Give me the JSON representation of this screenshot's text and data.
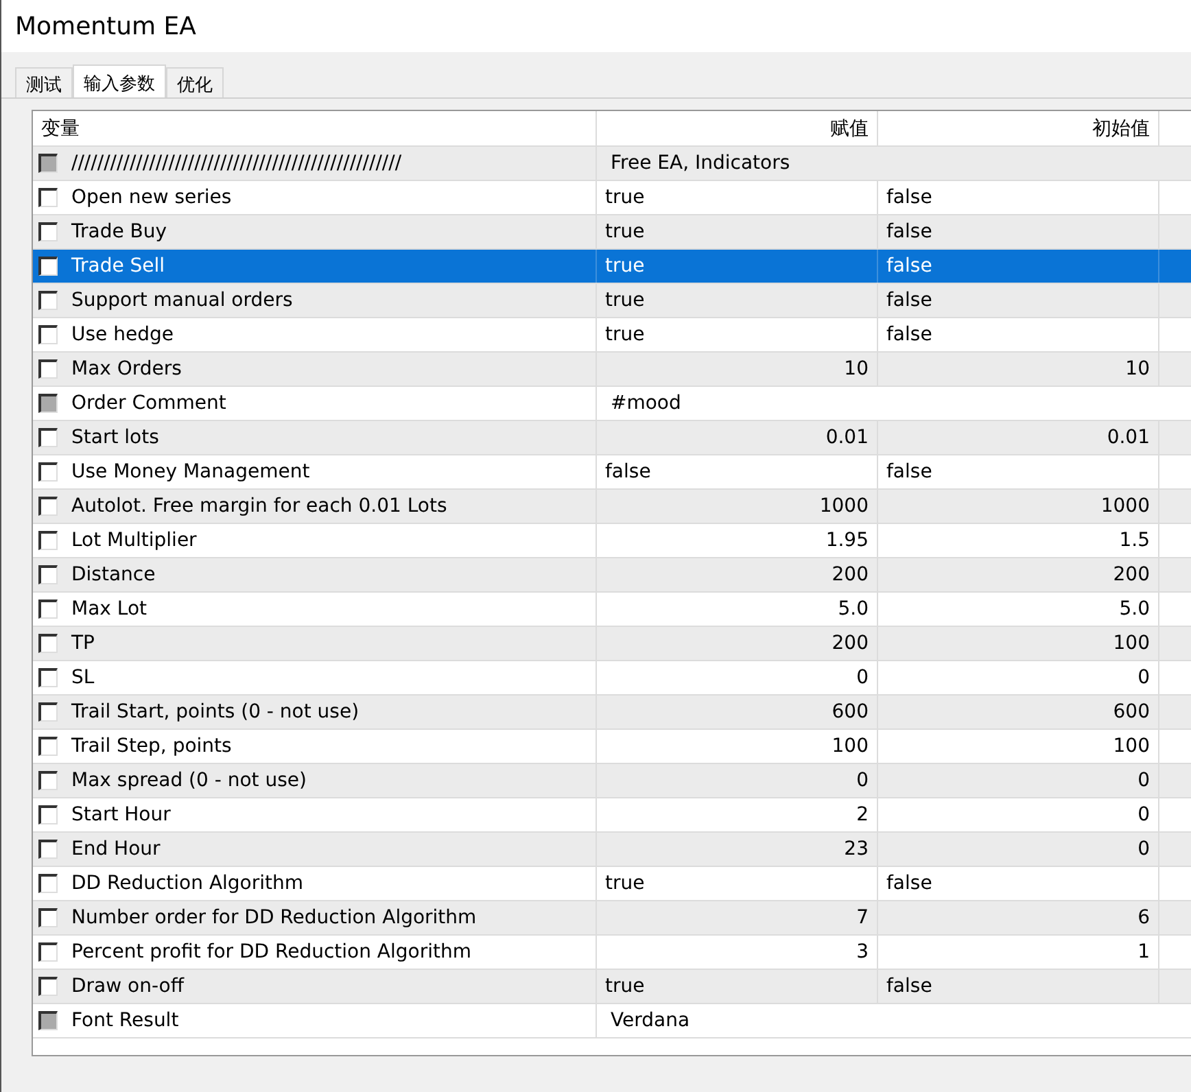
{
  "window": {
    "title": "Momentum EA"
  },
  "tabs": [
    {
      "label": "测试",
      "selected": false
    },
    {
      "label": "输入参数",
      "selected": true
    },
    {
      "label": "优化",
      "selected": false
    }
  ],
  "table": {
    "columns": [
      "变量",
      "赋值",
      "初始值"
    ],
    "rows": [
      {
        "kind": "text",
        "name": "///////////////////////////////////////////////////",
        "value": "Free EA, Indicators",
        "checked": false,
        "selected": false
      },
      {
        "kind": "bool",
        "name": "Open new series",
        "value": "true",
        "initial": "false",
        "checked": false,
        "selected": false
      },
      {
        "kind": "bool",
        "name": "Trade Buy",
        "value": "true",
        "initial": "false",
        "checked": false,
        "selected": false
      },
      {
        "kind": "bool",
        "name": "Trade Sell",
        "value": "true",
        "initial": "false",
        "checked": false,
        "selected": true
      },
      {
        "kind": "bool",
        "name": "Support manual orders",
        "value": "true",
        "initial": "false",
        "checked": false,
        "selected": false
      },
      {
        "kind": "bool",
        "name": "Use hedge",
        "value": "true",
        "initial": "false",
        "checked": false,
        "selected": false
      },
      {
        "kind": "number",
        "name": "Max Orders",
        "value": "10",
        "initial": "10",
        "checked": false,
        "selected": false
      },
      {
        "kind": "text",
        "name": "Order Comment",
        "value": "#mood",
        "checked": false,
        "selected": false
      },
      {
        "kind": "number",
        "name": "Start lots",
        "value": "0.01",
        "initial": "0.01",
        "checked": false,
        "selected": false
      },
      {
        "kind": "bool",
        "name": "Use Money Management",
        "value": "false",
        "initial": "false",
        "checked": false,
        "selected": false
      },
      {
        "kind": "number",
        "name": "Autolot. Free margin for each 0.01 Lots",
        "value": "1000",
        "initial": "1000",
        "checked": false,
        "selected": false
      },
      {
        "kind": "number",
        "name": "Lot Multiplier",
        "value": "1.95",
        "initial": "1.5",
        "checked": false,
        "selected": false
      },
      {
        "kind": "number",
        "name": "Distance",
        "value": "200",
        "initial": "200",
        "checked": false,
        "selected": false
      },
      {
        "kind": "number",
        "name": "Max Lot",
        "value": "5.0",
        "initial": "5.0",
        "checked": false,
        "selected": false
      },
      {
        "kind": "number",
        "name": "TP",
        "value": "200",
        "initial": "100",
        "checked": false,
        "selected": false
      },
      {
        "kind": "number",
        "name": "SL",
        "value": "0",
        "initial": "0",
        "checked": false,
        "selected": false
      },
      {
        "kind": "number",
        "name": "Trail Start, points (0 - not use)",
        "value": "600",
        "initial": "600",
        "checked": false,
        "selected": false
      },
      {
        "kind": "number",
        "name": "Trail Step, points",
        "value": "100",
        "initial": "100",
        "checked": false,
        "selected": false
      },
      {
        "kind": "number",
        "name": "Max spread (0 - not use)",
        "value": "0",
        "initial": "0",
        "checked": false,
        "selected": false
      },
      {
        "kind": "number",
        "name": "Start Hour",
        "value": "2",
        "initial": "0",
        "checked": false,
        "selected": false
      },
      {
        "kind": "number",
        "name": "End Hour",
        "value": "23",
        "initial": "0",
        "checked": false,
        "selected": false
      },
      {
        "kind": "bool",
        "name": "DD Reduction Algorithm",
        "value": "true",
        "initial": "false",
        "checked": false,
        "selected": false
      },
      {
        "kind": "number",
        "name": "Number order for DD Reduction Algorithm",
        "value": "7",
        "initial": "6",
        "checked": false,
        "selected": false
      },
      {
        "kind": "number",
        "name": "Percent profit for DD Reduction Algorithm",
        "value": "3",
        "initial": "1",
        "checked": false,
        "selected": false
      },
      {
        "kind": "bool",
        "name": "Draw on-off",
        "value": "true",
        "initial": "false",
        "checked": false,
        "selected": false
      },
      {
        "kind": "text",
        "name": "Font Result",
        "value": "Verdana",
        "checked": false,
        "selected": false
      }
    ]
  }
}
